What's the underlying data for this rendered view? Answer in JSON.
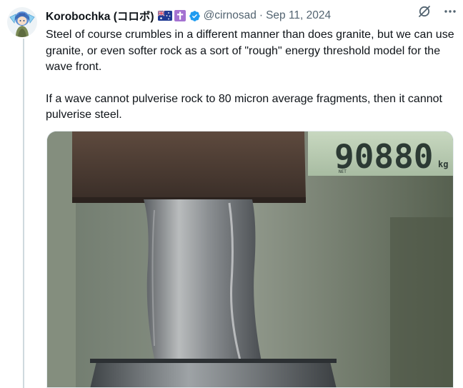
{
  "author": {
    "display_name": "Korobochka (コロボ)",
    "handle": "@cirnosad",
    "separator": "·",
    "date": "Sep 11, 2024",
    "badges": [
      "australia-flag-icon",
      "latin-cross-icon",
      "verified-badge-icon"
    ]
  },
  "actions": {
    "icons": [
      "grok-icon",
      "more-options-icon"
    ],
    "more_label": "···"
  },
  "tweet": {
    "paragraphs": [
      "Steel of course crumbles in a different manner than does granite, but we can use granite, or even softer rock as a sort of \"rough\" energy threshold model for the wave front.",
      "If a wave cannot pulverise rock to 80 micron average fragments, then it cannot pulverise steel."
    ]
  },
  "media": {
    "scale_reading": "90880",
    "scale_unit": "kg",
    "scale_small_label": "NET"
  },
  "colors": {
    "text": "#0f1419",
    "secondary": "#536471",
    "verified": "#1d9bf0",
    "thread_line": "#cfd9de"
  }
}
